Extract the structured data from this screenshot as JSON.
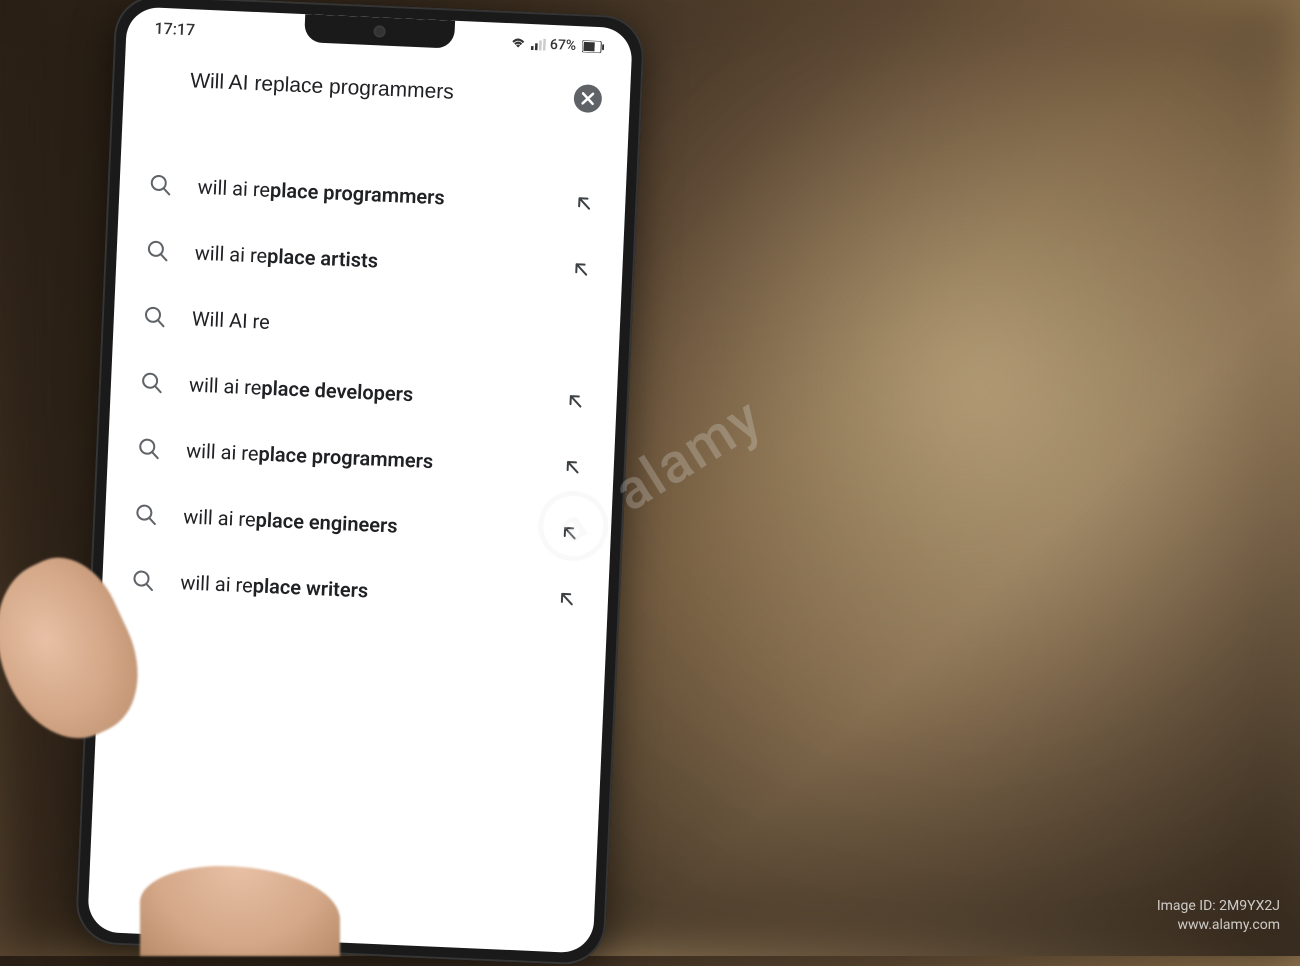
{
  "statusBar": {
    "time": "17:17",
    "battery": "67%"
  },
  "search": {
    "query": "Will AI replace programmers"
  },
  "suggestions": [
    {
      "prefix": "will ai re",
      "completion": "place programmers",
      "hasArrow": true
    },
    {
      "prefix": "will ai re",
      "completion": "place artists",
      "hasArrow": true
    },
    {
      "prefix": "Will AI re",
      "completion": "",
      "hasArrow": false
    },
    {
      "prefix": "will ai re",
      "completion": "place developers",
      "hasArrow": true
    },
    {
      "prefix": "will ai re",
      "completion": "place programmers",
      "hasArrow": true
    },
    {
      "prefix": "will ai re",
      "completion": "place engineers",
      "hasArrow": true
    },
    {
      "prefix": "will ai re",
      "completion": "place writers",
      "hasArrow": true
    }
  ],
  "watermark": {
    "brand": "alamy",
    "id": "Image ID: 2M9YX2J",
    "url": "www.alamy.com"
  }
}
